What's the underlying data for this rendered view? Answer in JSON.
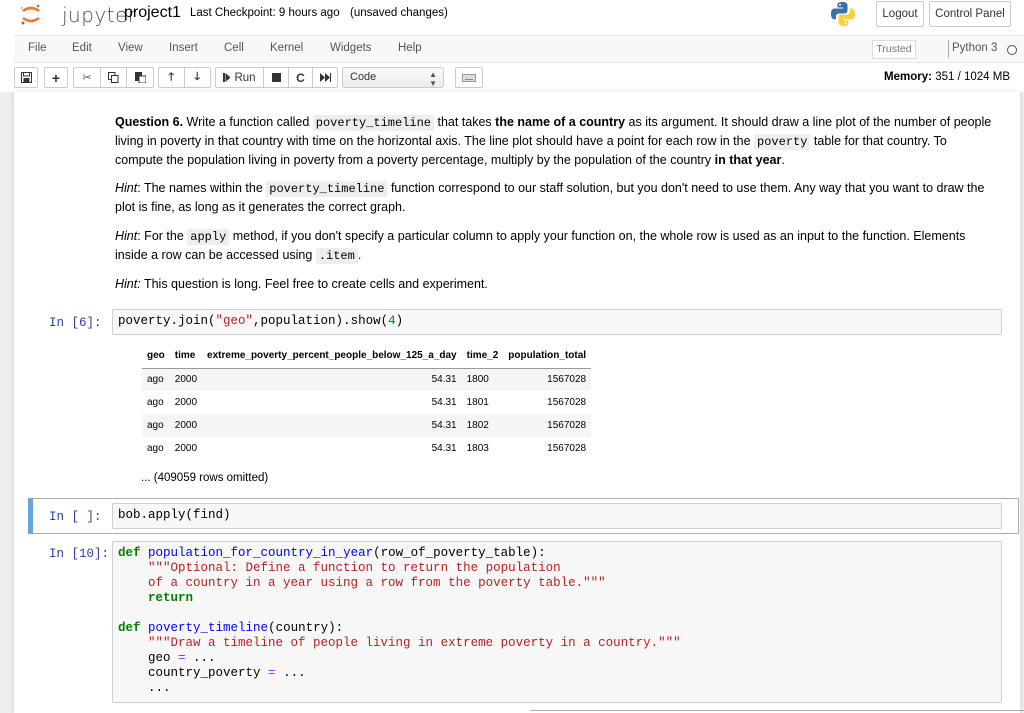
{
  "header": {
    "logo_text": "jupyter",
    "notebook_name": "project1",
    "checkpoint": "Last Checkpoint: 9 hours ago",
    "unsaved": "(unsaved changes)",
    "logout": "Logout",
    "control_panel": "Control Panel"
  },
  "menubar": {
    "items": [
      "File",
      "Edit",
      "View",
      "Insert",
      "Cell",
      "Kernel",
      "Widgets",
      "Help"
    ],
    "trusted": "Trusted",
    "kernel": "Python 3"
  },
  "toolbar": {
    "run_label": "Run",
    "cell_type": "Code",
    "memory_label": "Memory:",
    "memory_value": "351 / 1024 MB",
    "icons": [
      "save-icon",
      "insert-cell-below-icon",
      "cut-icon",
      "copy-icon",
      "paste-icon",
      "move-up-icon",
      "move-down-icon",
      "run-icon",
      "interrupt-icon",
      "restart-icon",
      "restart-run-all-icon",
      "keyboard-icon"
    ]
  },
  "markdown": {
    "q_label": "Question 6.",
    "q_p1": " Write a function called ",
    "q_code1": "poverty_timeline",
    "q_p2": " that takes ",
    "q_bold1": "the name of a country",
    "q_p3": " as its argument. It should draw a line plot of the number of people living in poverty in that country with time on the horizontal axis. The line plot should have a point for each row in the ",
    "q_code2": "poverty",
    "q_p4": " table for that country. To compute the population living in poverty from a poverty percentage, multiply by the population of the country ",
    "q_bold2": "in that year",
    "q_p5": ".",
    "h1_label": "Hint",
    "h1_p1": ": The names within the ",
    "h1_code": "poverty_timeline",
    "h1_p2": " function correspond to our staff solution, but you don't need to use them. Any way that you want to draw the plot is fine, as long as it generates the correct graph.",
    "h2_label": "Hint",
    "h2_p1": ": For the ",
    "h2_code1": "apply",
    "h2_p2": " method, if you don't specify a particular column to apply your function on, the whole row is used as an input to the function. Elements inside a row can be accessed using ",
    "h2_code2": ".item",
    "h2_p3": ".",
    "h3_label": "Hint:",
    "h3_p1": " This question is long. Feel free to create cells and experiment."
  },
  "cells": [
    {
      "prompt": "In [6]:",
      "code_parts": [
        "poverty.join(",
        "\"geo\"",
        ",population).show(",
        "4",
        ")"
      ],
      "output": {
        "columns": [
          "geo",
          "time",
          "extreme_poverty_percent_people_below_125_a_day",
          "time_2",
          "population_total"
        ],
        "rows": [
          [
            "ago",
            "2000",
            "54.31",
            "1800",
            "1567028"
          ],
          [
            "ago",
            "2000",
            "54.31",
            "1801",
            "1567028"
          ],
          [
            "ago",
            "2000",
            "54.31",
            "1802",
            "1567028"
          ],
          [
            "ago",
            "2000",
            "54.31",
            "1803",
            "1567028"
          ]
        ],
        "omitted": "... (409059 rows omitted)"
      }
    },
    {
      "prompt": "In [ ]:",
      "code": "bob.apply(find)"
    },
    {
      "prompt": "In [10]:",
      "lines": {
        "l1_kw": "def",
        "l1_fn": "population_for_country_in_year",
        "l1_rest": "(row_of_poverty_table):",
        "l2": "\"\"\"Optional: Define a function to return the population",
        "l3": "of a country in a year using a row from the poverty table.\"\"\"",
        "l4": "return",
        "l6_kw": "def",
        "l6_fn": "poverty_timeline",
        "l6_rest": "(country):",
        "l7": "\"\"\"Draw a timeline of people living in extreme poverty in a country.\"\"\"",
        "l8_a": "geo ",
        "l8_op": "=",
        "l8_b": " ...",
        "l9_a": "country_poverty ",
        "l9_op": "=",
        "l9_b": " ...",
        "l10": "..."
      }
    }
  ]
}
